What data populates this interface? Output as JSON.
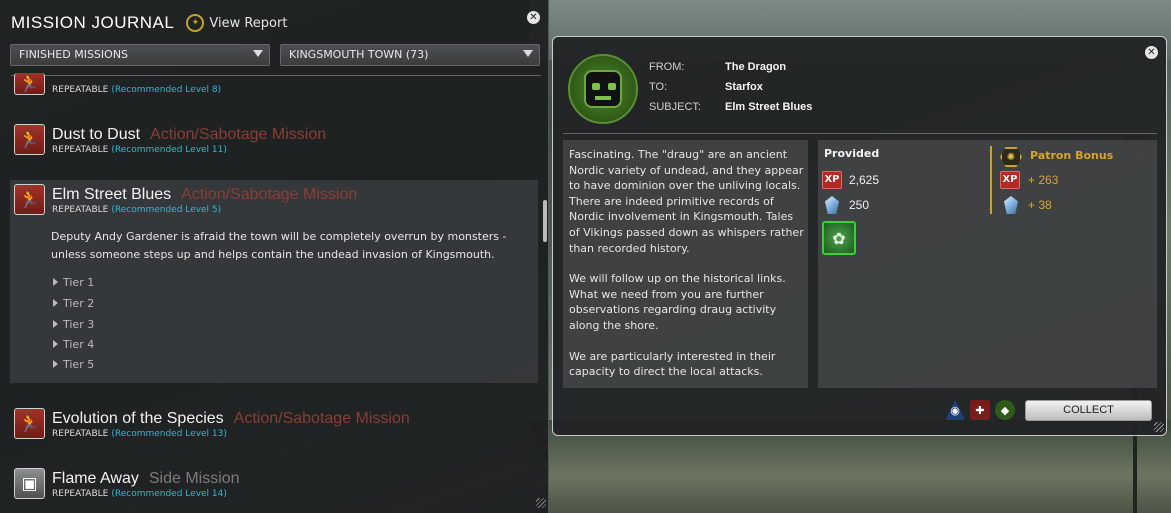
{
  "journal": {
    "title": "MISSION JOURNAL",
    "view_report": "View Report",
    "filter_left": "FINISHED MISSIONS",
    "filter_right": "KINGSMOUTH TOWN (73)",
    "missions": [
      {
        "name": "",
        "type": "",
        "repeatable": "REPEATABLE",
        "level": "(Recommended Level 8)"
      },
      {
        "name": "Dust to Dust",
        "type": "Action/Sabotage Mission",
        "repeatable": "REPEATABLE",
        "level": "(Recommended Level 11)"
      },
      {
        "name": "Elm Street Blues",
        "type": "Action/Sabotage Mission",
        "repeatable": "REPEATABLE",
        "level": "(Recommended Level 5)"
      },
      {
        "name": "Evolution of the Species",
        "type": "Action/Sabotage Mission",
        "repeatable": "REPEATABLE",
        "level": "(Recommended Level 13)"
      },
      {
        "name": "Flame Away",
        "type": "Side Mission",
        "repeatable": "REPEATABLE",
        "level": "(Recommended Level 14)"
      }
    ],
    "selected_description": "Deputy Andy Gardener is afraid the town will be completely overrun by monsters - unless someone steps up and helps contain the undead invasion of Kingsmouth.",
    "tiers": [
      "Tier 1",
      "Tier 2",
      "Tier 3",
      "Tier 4",
      "Tier 5"
    ]
  },
  "mail": {
    "from_label": "FROM:",
    "from_value": "The Dragon",
    "to_label": "TO:",
    "to_value": "Starfox",
    "subject_label": "SUBJECT:",
    "subject_value": "Elm Street Blues",
    "body_p1": "Fascinating. The \"draug\" are an ancient Nordic variety of undead, and they appear to have dominion over the unliving locals. There are indeed primitive records of Nordic involvement in Kingsmouth. Tales of Vikings passed down as whispers rather than recorded history.",
    "body_p2": "We will follow up on the historical links. What we need from you are further observations regarding draug activity along the shore.",
    "body_p3": "We are particularly interested in their capacity to direct the local attacks.",
    "provided_label": "Provided",
    "xp_icon_text": "XP",
    "xp_value": "2,625",
    "currency_value": "250",
    "patron_label": "Patron Bonus",
    "patron_xp": "+ 263",
    "patron_currency": "+ 38",
    "collect_label": "COLLECT"
  },
  "icons": {
    "close": "close-icon",
    "report": "dragon-emblem-icon",
    "mission_action": "running-man-icon",
    "mission_side": "cube-icon"
  },
  "colors": {
    "mission_type_action": "#8b3e33",
    "recommended_level": "#2fb7d8",
    "patron_gold": "#d8a52a",
    "item_highlight": "#39d13a"
  }
}
